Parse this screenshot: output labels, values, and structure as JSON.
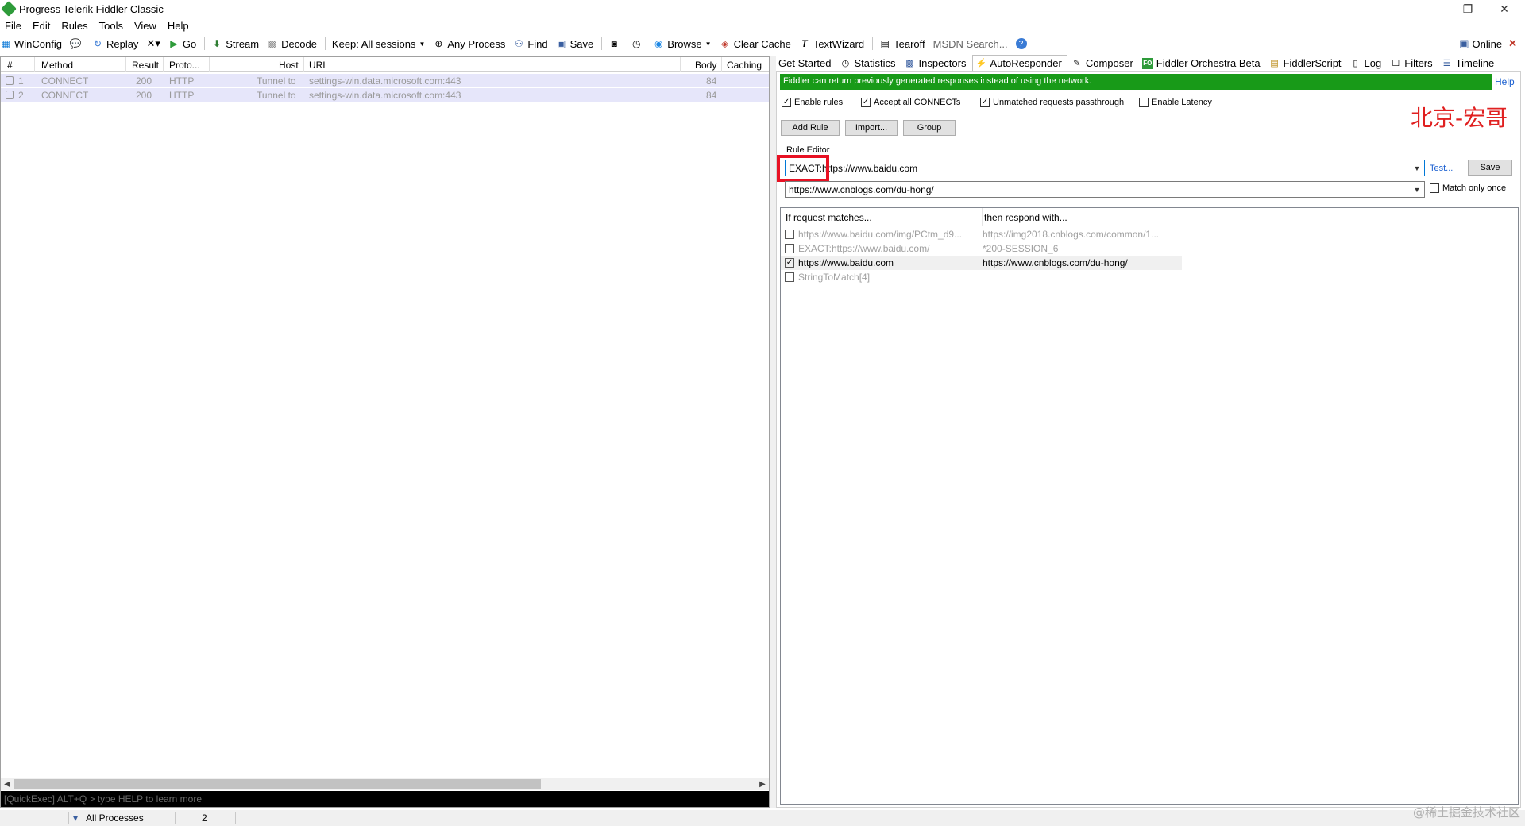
{
  "window": {
    "title": "Progress Telerik Fiddler Classic",
    "controls": {
      "minimize": "—",
      "restore": "❐",
      "close": "✕"
    }
  },
  "menu": [
    "File",
    "Edit",
    "Rules",
    "Tools",
    "View",
    "Help"
  ],
  "toolbar": {
    "winconfig": "WinConfig",
    "replay": "Replay",
    "remove": "✕▾",
    "go": "Go",
    "stream": "Stream",
    "decode": "Decode",
    "keep": "Keep: All sessions",
    "any_process": "Any Process",
    "find": "Find",
    "save": "Save",
    "browse": "Browse",
    "clear_cache": "Clear Cache",
    "textwizard": "TextWizard",
    "tearoff": "Tearoff",
    "msdn_search": "MSDN Search...",
    "online": "Online"
  },
  "sessions": {
    "columns": [
      "#",
      "Method",
      "Result",
      "Proto...",
      "Host",
      "URL",
      "Body",
      "Caching"
    ],
    "rows": [
      {
        "num": "1",
        "method": "CONNECT",
        "result": "200",
        "protocol": "HTTP",
        "host": "Tunnel to",
        "url": "settings-win.data.microsoft.com:443",
        "body": "84",
        "caching": ""
      },
      {
        "num": "2",
        "method": "CONNECT",
        "result": "200",
        "protocol": "HTTP",
        "host": "Tunnel to",
        "url": "settings-win.data.microsoft.com:443",
        "body": "84",
        "caching": ""
      }
    ],
    "quickexec_placeholder": "[QuickExec] ALT+Q > type HELP to learn more"
  },
  "tabs": [
    {
      "label": "Get Started",
      "icon": ""
    },
    {
      "label": "Statistics",
      "icon": "stopwatch-icon"
    },
    {
      "label": "Inspectors",
      "icon": "inspect-icon"
    },
    {
      "label": "AutoResponder",
      "icon": "lightning-icon"
    },
    {
      "label": "Composer",
      "icon": "compose-icon"
    },
    {
      "label": "Fiddler Orchestra Beta",
      "icon": "fo-icon"
    },
    {
      "label": "FiddlerScript",
      "icon": "script-icon"
    },
    {
      "label": "Log",
      "icon": "log-icon"
    },
    {
      "label": "Filters",
      "icon": "filter-icon"
    },
    {
      "label": "Timeline",
      "icon": "timeline-icon"
    }
  ],
  "autoresponder": {
    "banner": "Fiddler can return previously generated responses instead of using the network.",
    "help": "Help",
    "options": {
      "enable_rules": "Enable rules",
      "accept_connects": "Accept all CONNECTs",
      "unmatched_passthrough": "Unmatched requests passthrough",
      "enable_latency": "Enable Latency"
    },
    "watermark": "北京-宏哥",
    "buttons": {
      "add_rule": "Add Rule",
      "import": "Import...",
      "group": "Group"
    },
    "rule_editor_label": "Rule Editor",
    "match_value": "EXACT:https://www.baidu.com",
    "response_value": "https://www.cnblogs.com/du-hong/",
    "test": "Test...",
    "save": "Save",
    "match_only_once": "Match only once",
    "list_headers": {
      "match": "If request matches...",
      "respond": "then respond with..."
    },
    "rules": [
      {
        "checked": false,
        "match": "https://www.baidu.com/img/PCtm_d9...",
        "respond": "https://img2018.cnblogs.com/common/1...",
        "dim": true
      },
      {
        "checked": false,
        "match": "EXACT:https://www.baidu.com/",
        "respond": "*200-SESSION_6",
        "dim": true
      },
      {
        "checked": true,
        "match": "https://www.baidu.com",
        "respond": "https://www.cnblogs.com/du-hong/",
        "dim": false
      },
      {
        "checked": false,
        "match": "StringToMatch[4]",
        "respond": "",
        "dim": true
      }
    ]
  },
  "status": {
    "process_filter": "All Processes",
    "count": "2"
  },
  "corner_watermark": "@稀土掘金技术社区"
}
